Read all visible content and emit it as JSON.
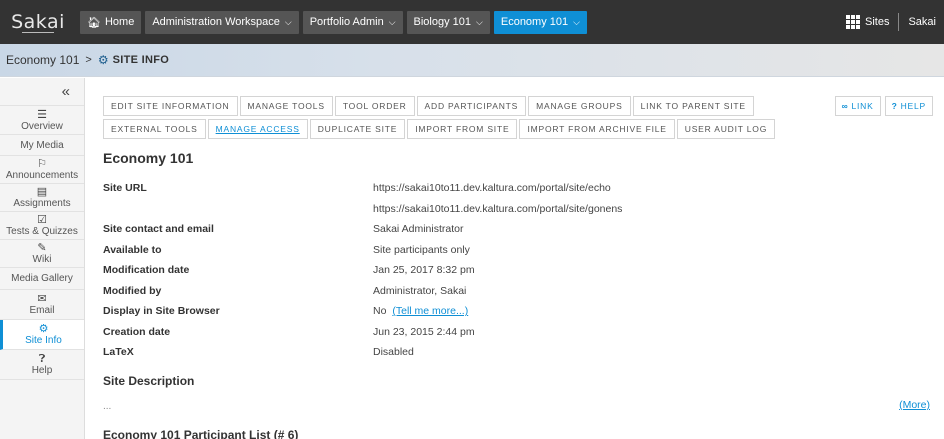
{
  "topbar": {
    "logo": "Sakai",
    "nav": [
      {
        "label": "Home",
        "has_home_icon": true,
        "chevron": false
      },
      {
        "label": "Administration Workspace",
        "chevron": true
      },
      {
        "label": "Portfolio Admin",
        "chevron": true
      },
      {
        "label": "Biology 101",
        "chevron": true
      },
      {
        "label": "Economy 101",
        "chevron": true,
        "active": true
      }
    ],
    "sites_label": "Sites",
    "user_label": "Sakai"
  },
  "breadcrumb": {
    "site": "Economy 101",
    "separator": ">",
    "tool": "SITE INFO"
  },
  "sidebar": {
    "collapse": "«",
    "items": [
      {
        "label": "Overview",
        "icon": "list-icon"
      },
      {
        "label": "My Media",
        "icon": ""
      },
      {
        "label": "Announcements",
        "icon": "megaphone-icon"
      },
      {
        "label": "Assignments",
        "icon": "file-icon"
      },
      {
        "label": "Tests & Quizzes",
        "icon": "checkbox-icon"
      },
      {
        "label": "Wiki",
        "icon": "edit-icon"
      },
      {
        "label": "Media Gallery",
        "icon": ""
      },
      {
        "label": "Email",
        "icon": "envelope-icon"
      },
      {
        "label": "Site Info",
        "icon": "gear-icon",
        "active": true
      },
      {
        "label": "Help",
        "icon": "question-icon"
      }
    ]
  },
  "toolbar": {
    "row1": [
      "EDIT SITE INFORMATION",
      "MANAGE TOOLS",
      "TOOL ORDER",
      "ADD PARTICIPANTS",
      "MANAGE GROUPS",
      "LINK TO PARENT SITE"
    ],
    "row2": [
      "EXTERNAL TOOLS",
      "MANAGE ACCESS",
      "DUPLICATE SITE",
      "IMPORT FROM SITE",
      "IMPORT FROM ARCHIVE FILE",
      "USER AUDIT LOG"
    ],
    "current": "MANAGE ACCESS",
    "link_label": "LINK",
    "help_label": "HELP"
  },
  "site": {
    "title": "Economy 101",
    "rows": [
      {
        "label": "Site URL",
        "value": "https://sakai10to11.dev.kaltura.com/portal/site/echo"
      },
      {
        "label": "",
        "value": "https://sakai10to11.dev.kaltura.com/portal/site/gonens"
      },
      {
        "label": "Site contact and email",
        "value": "Sakai Administrator"
      },
      {
        "label": "Available to",
        "value": "Site participants only"
      },
      {
        "label": "Modification date",
        "value": "Jan 25, 2017 8:32 pm"
      },
      {
        "label": "Modified by",
        "value": "Administrator, Sakai"
      },
      {
        "label": "Display in Site Browser",
        "value": "No",
        "link": "(Tell me more...)"
      },
      {
        "label": "Creation date",
        "value": "Jun 23, 2015 2:44 pm"
      },
      {
        "label": "LaTeX",
        "value": "Disabled"
      }
    ],
    "description_title": "Site Description",
    "description_text": "...",
    "more_link": "(More)",
    "participants_title": "Economy 101 Participant List (# 6)"
  }
}
